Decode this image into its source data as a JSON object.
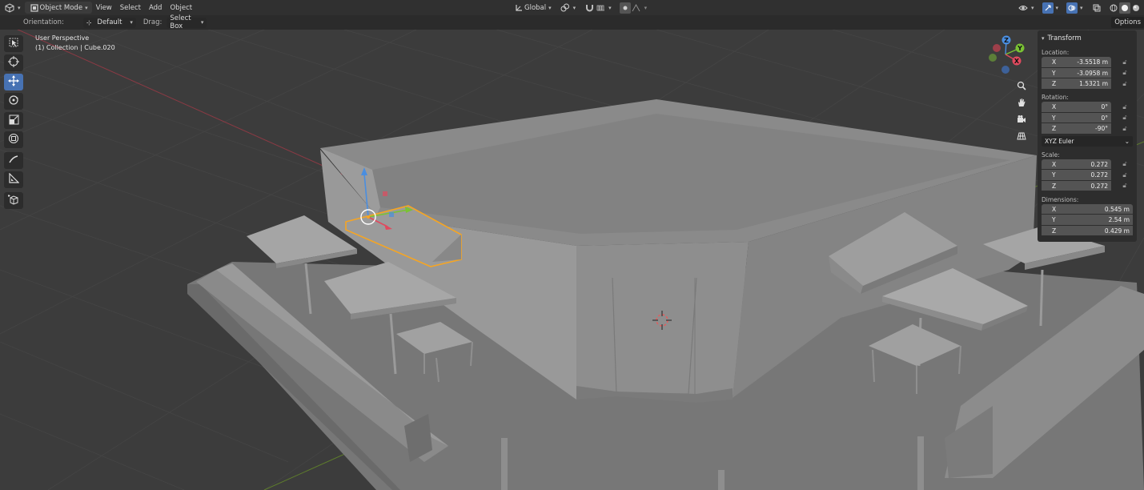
{
  "header": {
    "editor_icon": "cube-editor-icon",
    "mode": "Object Mode",
    "menus": [
      "View",
      "Select",
      "Add",
      "Object"
    ],
    "transform_orientation": "Global",
    "pivot_icon": "pivot-icon",
    "snap_icon": "magnet-icon",
    "proportional_icon": "proportional-edit-icon"
  },
  "tool_settings": {
    "orientation_label": "Orientation:",
    "orientation_value": "Default",
    "drag_label": "Drag:",
    "drag_value": "Select Box",
    "options_label": "Options"
  },
  "viewport": {
    "view_name": "User Perspective",
    "collection_info": "(1) Collection | Cube.020"
  },
  "gizmo": {
    "x": "X",
    "y": "Y",
    "z": "Z"
  },
  "transform_panel": {
    "title": "Transform",
    "location_label": "Location:",
    "location": [
      {
        "axis": "X",
        "value": "-3.5518 m"
      },
      {
        "axis": "Y",
        "value": "-3.0958 m"
      },
      {
        "axis": "Z",
        "value": "1.5321 m"
      }
    ],
    "rotation_label": "Rotation:",
    "rotation": [
      {
        "axis": "X",
        "value": "0°"
      },
      {
        "axis": "Y",
        "value": "0°"
      },
      {
        "axis": "Z",
        "value": "-90°"
      }
    ],
    "rotation_mode": "XYZ Euler",
    "scale_label": "Scale:",
    "scale": [
      {
        "axis": "X",
        "value": "0.272"
      },
      {
        "axis": "Y",
        "value": "0.272"
      },
      {
        "axis": "Z",
        "value": "0.272"
      }
    ],
    "dimensions_label": "Dimensions:",
    "dimensions": [
      {
        "axis": "X",
        "value": "0.545 m"
      },
      {
        "axis": "Y",
        "value": "2.54 m"
      },
      {
        "axis": "Z",
        "value": "0.429 m"
      }
    ]
  },
  "colors": {
    "active_tool": "#4772b3",
    "selection_outline": "#f5a524",
    "axis_x": "#e04a5e",
    "axis_y": "#7ac234",
    "axis_z": "#4a8ee0",
    "grid_x_line": "#8a3a44",
    "grid_y_line": "#5e7d2c"
  }
}
